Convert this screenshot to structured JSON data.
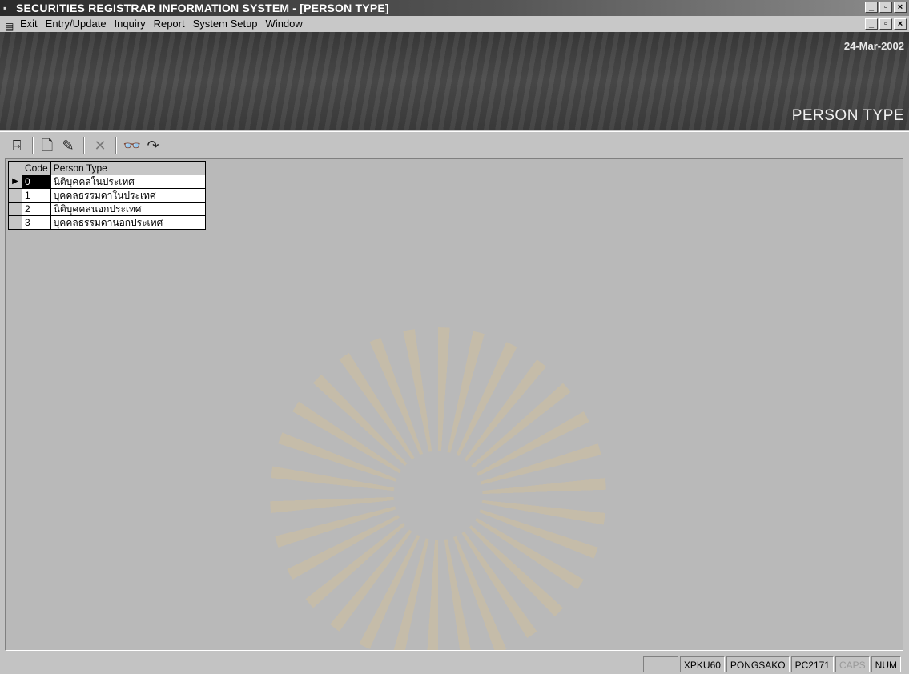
{
  "window": {
    "title": "SECURITIES REGISTRAR INFORMATION SYSTEM - [PERSON TYPE]",
    "controls": {
      "minimize": "_",
      "restore": "▫",
      "close": "×"
    }
  },
  "menu": {
    "items": [
      "Exit",
      "Entry/Update",
      "Inquiry",
      "Report",
      "System Setup",
      "Window"
    ]
  },
  "header": {
    "date": "24-Mar-2002",
    "screen_title": "PERSON TYPE"
  },
  "toolbar": {
    "buttons": [
      {
        "name": "exit-door-icon",
        "glyph": "⍈"
      },
      {
        "name": "new-document-icon",
        "glyph": "🗋"
      },
      {
        "name": "edit-pencil-icon",
        "glyph": "✎"
      },
      {
        "name": "delete-x-icon",
        "glyph": "✕"
      },
      {
        "name": "find-binoculars-icon",
        "glyph": "👓"
      },
      {
        "name": "redo-arrow-icon",
        "glyph": "↷"
      }
    ]
  },
  "grid": {
    "headers": {
      "code": "Code",
      "person_type": "Person Type"
    },
    "rows": [
      {
        "code": "0",
        "person_type": "นิติบุคคลในประเทศ"
      },
      {
        "code": "1",
        "person_type": "บุคคลธรรมดาในประเทศ"
      },
      {
        "code": "2",
        "person_type": "นิติบุคคลนอกประเทศ"
      },
      {
        "code": "3",
        "person_type": "บุคคลธรรมดานอกประเทศ"
      }
    ],
    "current_row_marker": "▶"
  },
  "status": {
    "panels": [
      "XPKU60",
      "PONGSAKO",
      "PC2171",
      "CAPS",
      "NUM"
    ]
  }
}
